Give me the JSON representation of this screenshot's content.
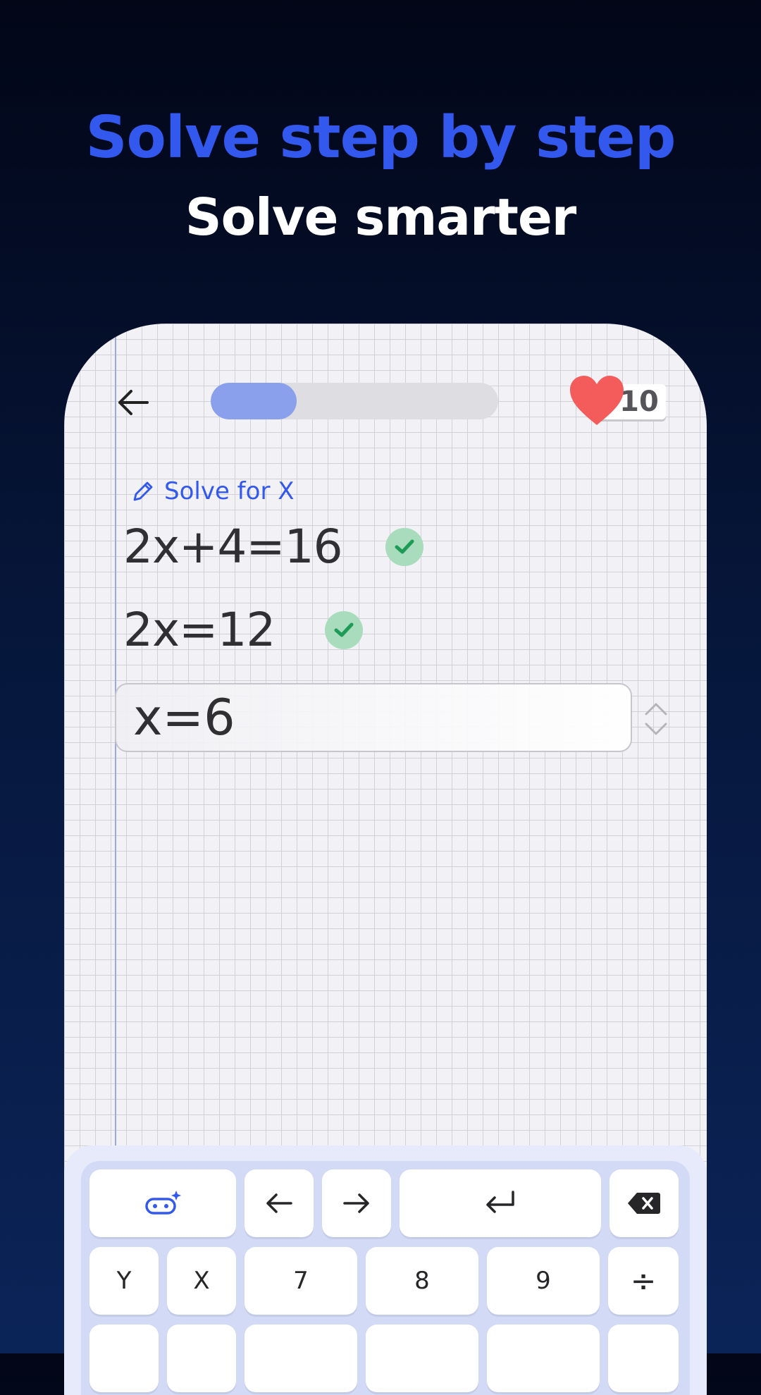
{
  "headline": {
    "title": "Solve step by step",
    "subtitle": "Solve smarter"
  },
  "colors": {
    "accent": "#3358ee",
    "heart": "#f45b5b",
    "check_bg": "#a9dcbd",
    "check": "#1e9b56"
  },
  "header": {
    "back_icon": "arrow-left-icon",
    "progress_fraction": 0.3,
    "lives_count": "10",
    "lives_icon": "heart-icon"
  },
  "problem": {
    "task_icon": "pencil-icon",
    "task_label": "Solve for X",
    "steps": [
      {
        "text": "2x+4=16",
        "status": "correct"
      },
      {
        "text": "2x=12",
        "status": "correct"
      }
    ],
    "answer_value": "x=6",
    "stepper_icon": "chevron-up-down-icon"
  },
  "keyboard": {
    "row1": [
      "gamepad-sparkle-icon",
      "arrow-left-icon",
      "arrow-right-icon",
      "enter-icon",
      "backspace-icon"
    ],
    "row2": [
      "Y",
      "X",
      "7",
      "8",
      "9",
      "÷"
    ]
  }
}
